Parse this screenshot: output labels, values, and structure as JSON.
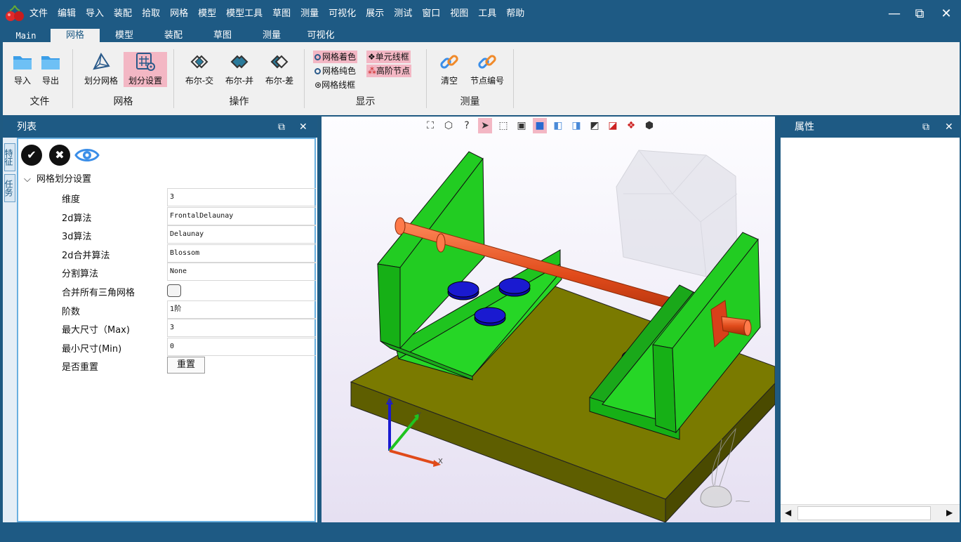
{
  "app": {
    "menu": [
      "文件",
      "编辑",
      "导入",
      "装配",
      "拾取",
      "网格",
      "模型",
      "模型工具",
      "草图",
      "测量",
      "可视化",
      "展示",
      "测试",
      "窗口",
      "视图",
      "工具",
      "帮助"
    ],
    "window_controls": {
      "minimize": "—",
      "maximize": "⧉",
      "close": "✕"
    }
  },
  "ribbon_tabs": [
    "Main",
    "网格",
    "模型",
    "装配",
    "草图",
    "测量",
    "可视化"
  ],
  "ribbon": {
    "groups": {
      "file": {
        "label": "文件",
        "import": "导入",
        "export": "导出"
      },
      "mesh": {
        "label": "网格",
        "divide": "划分网格",
        "settings": "划分设置"
      },
      "ops": {
        "label": "操作",
        "intersect": "布尔-交",
        "union": "布尔-并",
        "diff": "布尔-差"
      },
      "display": {
        "label": "显示",
        "opt1": "网格着色",
        "opt2": "单元线框",
        "opt3": "网格纯色",
        "opt4": "高阶节点",
        "opt5": "网格线框"
      },
      "measure": {
        "label": "测量",
        "clear": "清空",
        "node_number": "节点编号"
      }
    }
  },
  "left_panel": {
    "title": "列表",
    "vtabs": [
      "特征",
      "任务"
    ],
    "tree_root": "网格划分设置",
    "properties": [
      {
        "key": "维度",
        "value": "3"
      },
      {
        "key": "2d算法",
        "value": "FrontalDelaunay"
      },
      {
        "key": "3d算法",
        "value": "Delaunay"
      },
      {
        "key": "2d合并算法",
        "value": "Blossom"
      },
      {
        "key": "分割算法",
        "value": "None"
      },
      {
        "key": "合并所有三角网格",
        "value": ""
      },
      {
        "key": "阶数",
        "value": "1阶"
      },
      {
        "key": "最大尺寸（Max)",
        "value": "3"
      },
      {
        "key": "最小尺寸(Min)",
        "value": "0"
      },
      {
        "key": "是否重置",
        "value": "重置"
      }
    ]
  },
  "viewport": {
    "axes": {
      "x": "X",
      "y": "Y",
      "z": "Z"
    }
  },
  "right_panel": {
    "title": "属性"
  }
}
